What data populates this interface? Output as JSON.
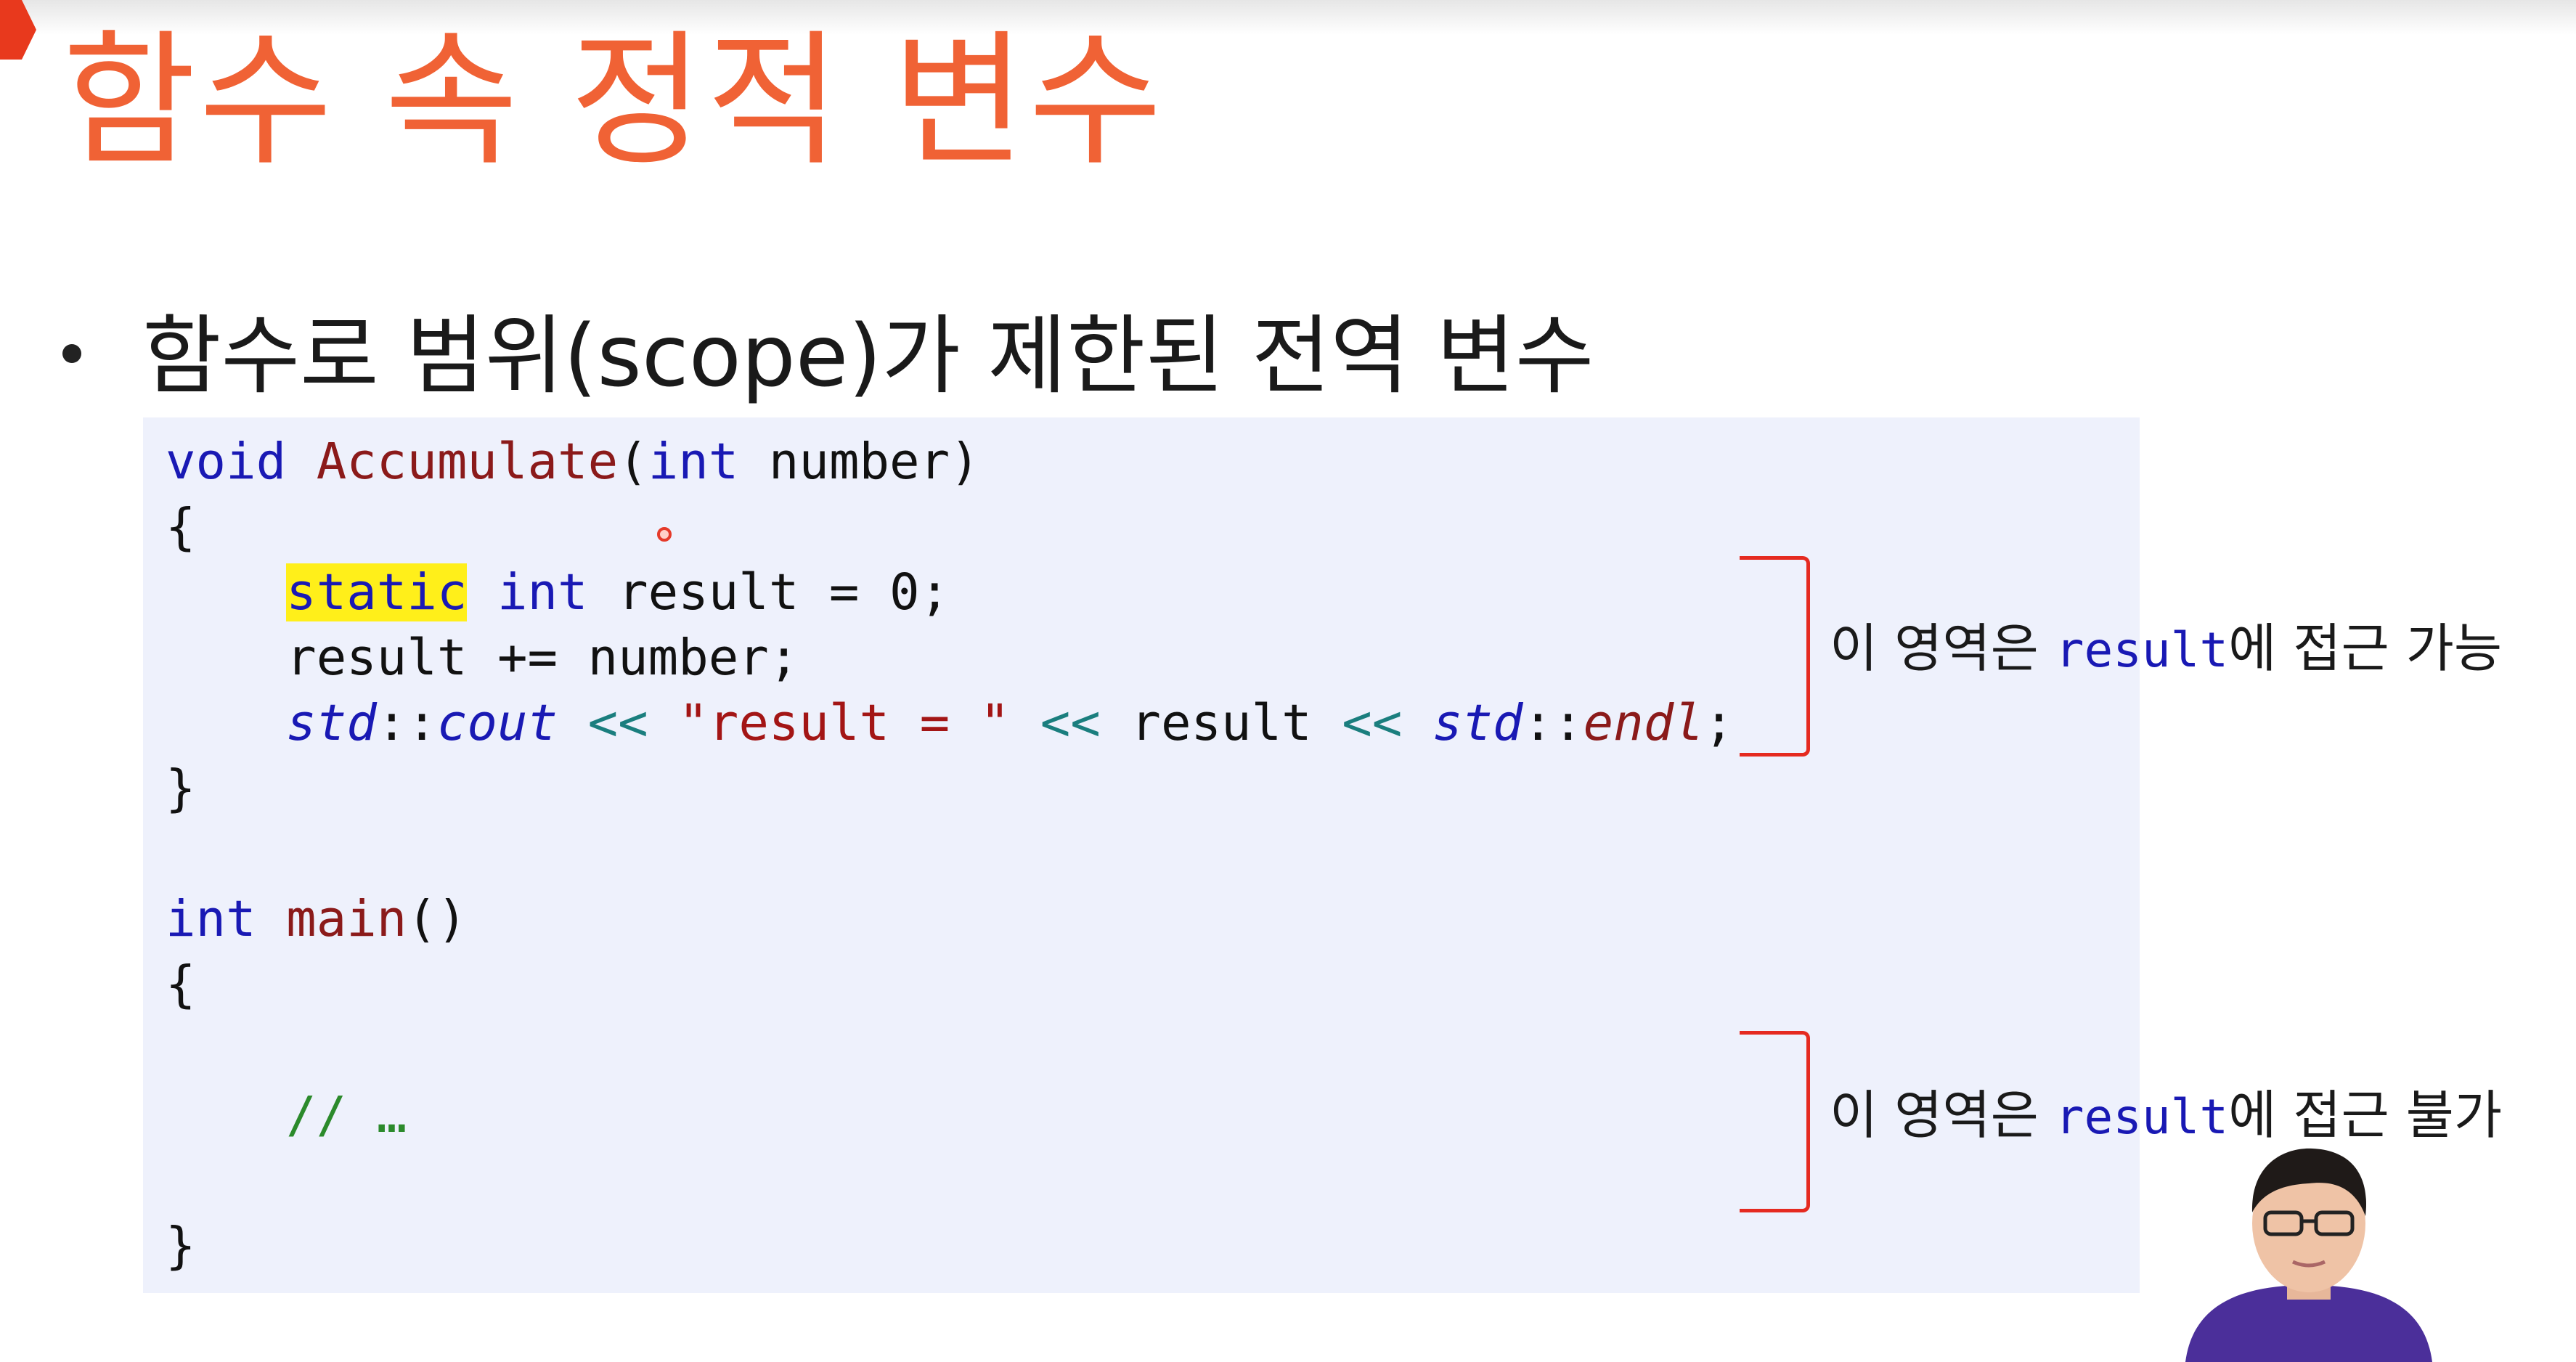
{
  "slide": {
    "title": "함수 속 정적 변수",
    "bullet": "함수로 범위(scope)가 제한된 전역 변수"
  },
  "code": {
    "l1": {
      "kw_void": "void",
      "fn_name": "Accumulate",
      "open": "(",
      "kw_int": "int",
      "param": "number)"
    },
    "l2": "{",
    "l3": {
      "indent": "    ",
      "kw_static": "static",
      "kw_int": "int",
      "rest": "result = 0;"
    },
    "l4": "    result += number;",
    "l5": {
      "indent": "    ",
      "ns1": "std",
      "sep1": "::",
      "cout": "cout",
      "op1": "<<",
      "str": "\"result = \"",
      "op2": "<<",
      "var": "result",
      "op3": "<<",
      "ns2": "std",
      "sep2": "::",
      "endl": "endl",
      "semi": ";"
    },
    "l6": "}",
    "l8": {
      "kw_int": "int",
      "fn_main": "main",
      "parens": "()"
    },
    "l9": "{",
    "l11": {
      "indent": "    ",
      "comment": "// …"
    },
    "l13": "}"
  },
  "annotations": {
    "accessible": {
      "pre": "이 영역은 ",
      "var": "result",
      "post": "에 접근 가능"
    },
    "inaccessible": {
      "pre": "이 영역은 ",
      "var": "result",
      "post": "에 접근 불가"
    }
  },
  "colors": {
    "title": "#f06235",
    "code_background": "#eef1fc",
    "keyword": "#1919b4",
    "function": "#8b1a1a",
    "string": "#a31515",
    "comment": "#2b8a2b",
    "highlight": "#ffef1a",
    "bracket": "#e52a20"
  }
}
